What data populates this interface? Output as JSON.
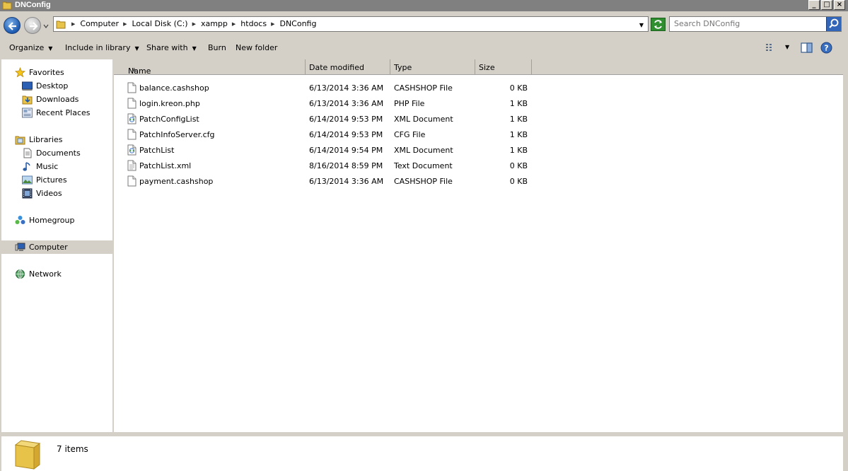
{
  "window": {
    "title": "DNConfig",
    "minimize": "_",
    "maximize": "□",
    "close": "×"
  },
  "address": {
    "crumbs": [
      "Computer",
      "Local Disk (C:)",
      "xampp",
      "htdocs",
      "DNConfig"
    ],
    "search_placeholder": "Search DNConfig"
  },
  "toolbar": {
    "organize": "Organize",
    "include_in_library": "Include in library",
    "share_with": "Share with",
    "burn": "Burn",
    "new_folder": "New folder"
  },
  "nav": {
    "favorites": "Favorites",
    "desktop": "Desktop",
    "downloads": "Downloads",
    "recent_places": "Recent Places",
    "libraries": "Libraries",
    "documents": "Documents",
    "music": "Music",
    "pictures": "Pictures",
    "videos": "Videos",
    "homegroup": "Homegroup",
    "computer": "Computer",
    "network": "Network"
  },
  "columns": {
    "name": "Name",
    "date": "Date modified",
    "type": "Type",
    "size": "Size"
  },
  "files": [
    {
      "name": "balance.cashshop",
      "date": "6/13/2014 3:36 AM",
      "type": "CASHSHOP File",
      "size": "0 KB",
      "icon": "file-icon"
    },
    {
      "name": "login.kreon.php",
      "date": "6/13/2014 3:36 AM",
      "type": "PHP File",
      "size": "1 KB",
      "icon": "file-icon"
    },
    {
      "name": "PatchConfigList",
      "date": "6/14/2014 9:53 PM",
      "type": "XML Document",
      "size": "1 KB",
      "icon": "xml-icon"
    },
    {
      "name": "PatchInfoServer.cfg",
      "date": "6/14/2014 9:53 PM",
      "type": "CFG File",
      "size": "1 KB",
      "icon": "file-icon"
    },
    {
      "name": "PatchList",
      "date": "6/14/2014 9:54 PM",
      "type": "XML Document",
      "size": "1 KB",
      "icon": "xml-icon"
    },
    {
      "name": "PatchList.xml",
      "date": "8/16/2014 8:59 PM",
      "type": "Text Document",
      "size": "0 KB",
      "icon": "text-file-icon"
    },
    {
      "name": "payment.cashshop",
      "date": "6/13/2014 3:36 AM",
      "type": "CASHSHOP File",
      "size": "0 KB",
      "icon": "file-icon"
    }
  ],
  "status": {
    "item_count": "7 items"
  }
}
